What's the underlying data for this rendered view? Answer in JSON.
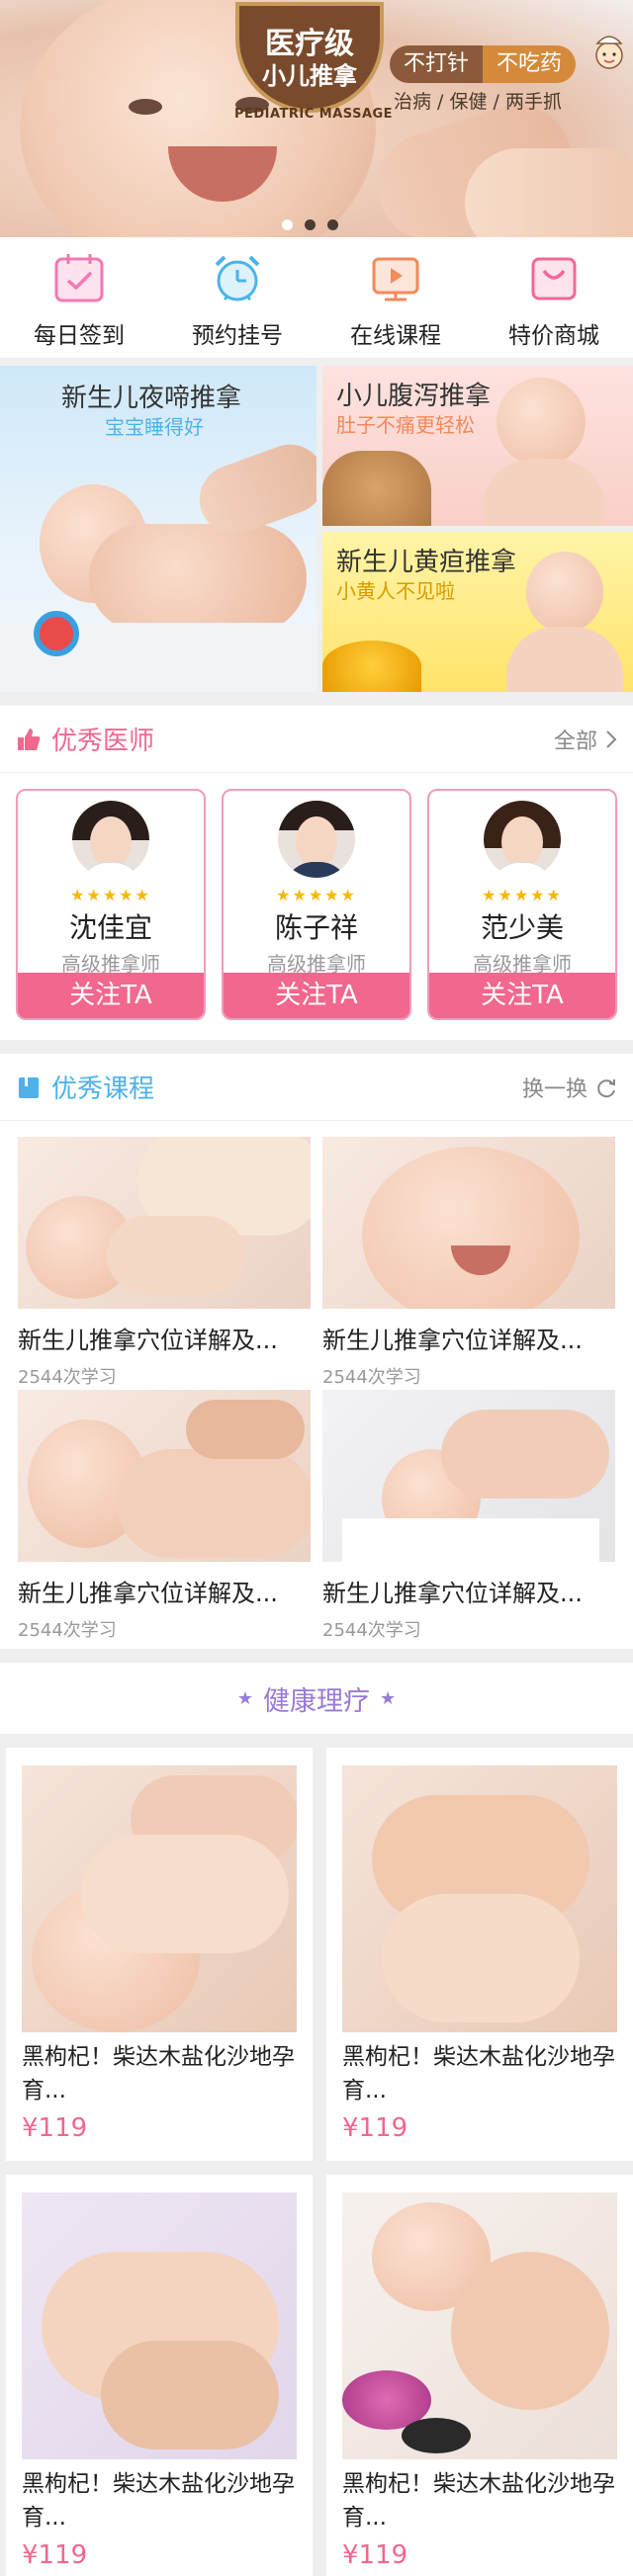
{
  "banner": {
    "badge_line1": "医疗级",
    "badge_line2": "小儿推拿",
    "badge_sub": "PEDIATRIC MASSAGE",
    "pill_a": "不打针",
    "pill_b": "不吃药",
    "tagline": "治病 / 保健 / 两手抓"
  },
  "nav": {
    "items": [
      {
        "label": "每日签到",
        "icon": "calendar-check-icon"
      },
      {
        "label": "预约挂号",
        "icon": "alarm-clock-icon"
      },
      {
        "label": "在线课程",
        "icon": "tv-play-icon"
      },
      {
        "label": "特价商城",
        "icon": "shopping-bag-icon"
      }
    ]
  },
  "promos": {
    "left": {
      "title": "新生儿夜啼推拿",
      "sub": "宝宝睡得好"
    },
    "right_top": {
      "title": "小儿腹泻推拿",
      "sub": "肚子不痛更轻松"
    },
    "right_bottom": {
      "title": "新生儿黄疸推拿",
      "sub": "小黄人不见啦"
    }
  },
  "doctors_section": {
    "title": "优秀医师",
    "more": "全部",
    "stars": "★★★★★",
    "follow_label": "关注TA",
    "items": [
      {
        "name": "沈佳宜",
        "title": "高级推拿师"
      },
      {
        "name": "陈子祥",
        "title": "高级推拿师"
      },
      {
        "name": "范少美",
        "title": "高级推拿师"
      }
    ]
  },
  "courses_section": {
    "title": "优秀课程",
    "more": "换一换",
    "items": [
      {
        "title": "新生儿推拿穴位详解及...",
        "meta": "2544次学习"
      },
      {
        "title": "新生儿推拿穴位详解及...",
        "meta": "2544次学习"
      },
      {
        "title": "新生儿推拿穴位详解及...",
        "meta": "2544次学习"
      },
      {
        "title": "新生儿推拿穴位详解及...",
        "meta": "2544次学习"
      }
    ]
  },
  "health_section": {
    "title": "健康理疗",
    "items": [
      {
        "title": "黑枸杞！柴达木盐化沙地孕育...",
        "price": "¥119"
      },
      {
        "title": "黑枸杞！柴达木盐化沙地孕育...",
        "price": "¥119"
      },
      {
        "title": "黑枸杞！柴达木盐化沙地孕育...",
        "price": "¥119"
      },
      {
        "title": "黑枸杞！柴达木盐化沙地孕育...",
        "price": "¥119"
      }
    ]
  },
  "colors": {
    "accent_pink": "#f1678e",
    "accent_blue": "#4bb3ea",
    "health_purple": "#9a7ad8"
  }
}
